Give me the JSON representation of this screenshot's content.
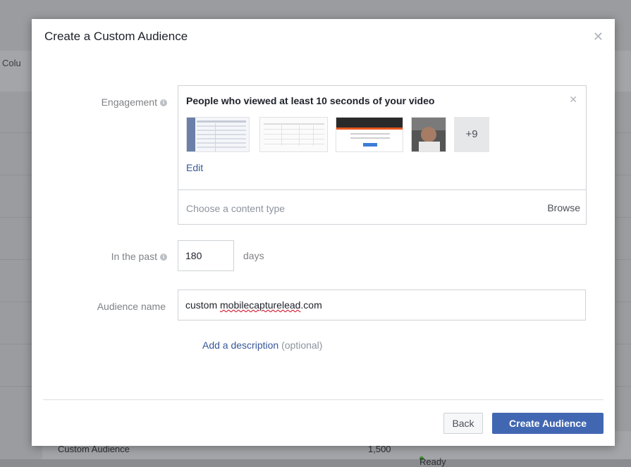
{
  "background": {
    "column_label": "Colu",
    "bottom_row": {
      "name": "Custom Audience",
      "size": "1,500",
      "status": "Ready"
    }
  },
  "modal": {
    "title": "Create a Custom Audience",
    "close_icon": "close-icon"
  },
  "engagement": {
    "label": "Engagement",
    "selected_title": "People who viewed at least 10 seconds of your video",
    "more_count": "+9",
    "edit_label": "Edit",
    "content_type_placeholder": "Choose a content type",
    "browse_label": "Browse"
  },
  "past": {
    "label": "In the past",
    "value": "180",
    "unit": "days"
  },
  "audience_name": {
    "label": "Audience name",
    "value_prefix": "custom ",
    "value_domain": "mobilecapturelead",
    "value_suffix": ".com"
  },
  "description": {
    "link_label": "Add a description",
    "optional_label": "(optional)"
  },
  "footer": {
    "back_label": "Back",
    "create_label": "Create Audience"
  },
  "colors": {
    "primary": "#4267b2",
    "link": "#365899"
  }
}
